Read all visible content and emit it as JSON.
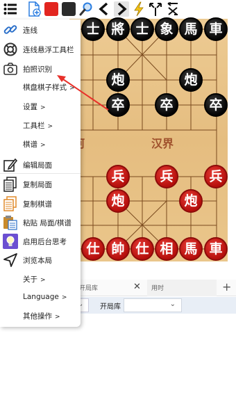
{
  "toolbar": {
    "icons": [
      "menu-icon",
      "new-file-icon",
      "red-square-icon",
      "black-square-icon",
      "search-icon",
      "back-icon",
      "forward-icon",
      "lightning-icon",
      "flip-icon",
      "swap-icon"
    ]
  },
  "board": {
    "river_left": "河",
    "river_right": "汉界",
    "black_pieces": [
      "士",
      "將",
      "士",
      "象",
      "馬",
      "車",
      "炮",
      "炮",
      "卒",
      "卒",
      "卒"
    ],
    "red_pieces": [
      "兵",
      "兵",
      "兵",
      "炮",
      "炮",
      "仕",
      "帥",
      "仕",
      "相",
      "馬",
      "車"
    ]
  },
  "menu": {
    "items": [
      {
        "label": "连线",
        "icon": "link-icon"
      },
      {
        "label": "连线悬浮工具栏",
        "icon": "floating-toolbar-icon"
      },
      {
        "label": "拍照识别",
        "icon": "camera-icon"
      },
      {
        "label": "棋盘棋子样式",
        "arrow": ">"
      },
      {
        "label": "设置",
        "arrow": ">"
      },
      {
        "label": "工具栏",
        "arrow": ">"
      },
      {
        "label": "棋谱",
        "arrow": ">"
      },
      {
        "label": "编辑局面",
        "icon": "edit-icon"
      },
      {
        "label": "复制局面",
        "icon": "copy-position-icon"
      },
      {
        "label": "复制棋谱",
        "icon": "copy-record-icon"
      },
      {
        "label": "粘贴 局面/棋谱",
        "icon": "paste-icon"
      },
      {
        "label": "启用后台思考",
        "icon": "lightbulb-icon"
      },
      {
        "label": "浏览本局",
        "icon": "navigate-icon"
      },
      {
        "label": "关于",
        "arrow": ">"
      },
      {
        "label": "Language",
        "arrow": ">"
      },
      {
        "label": "其他操作",
        "arrow": ">"
      }
    ]
  },
  "tabs": {
    "opening_book": "开局库",
    "time_used": "用时",
    "add": "+",
    "close": "✕"
  },
  "options": {
    "opening_book_label": "开局库",
    "chevron": "⌄"
  },
  "colors": {
    "accent_red": "#e2251f",
    "board": "#e9c48a",
    "arrow": "#e8302a"
  }
}
